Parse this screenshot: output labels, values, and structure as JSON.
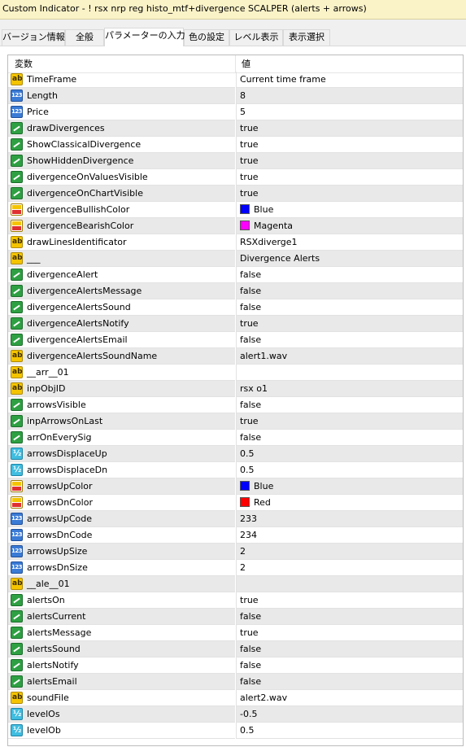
{
  "window": {
    "title": "Custom Indicator - ! rsx nrp reg histo_mtf+divergence SCALPER (alerts + arrows)"
  },
  "tabs": [
    {
      "label": "バージョン情報"
    },
    {
      "label": "全般"
    },
    {
      "label": "パラメーターの入力",
      "active": true
    },
    {
      "label": "色の設定"
    },
    {
      "label": "レベル表示"
    },
    {
      "label": "表示選択"
    }
  ],
  "grid": {
    "col_name": "変数",
    "col_value": "値",
    "rows": [
      {
        "name": "TimeFrame",
        "value": "Current time frame",
        "type": "ab"
      },
      {
        "name": "Length",
        "value": "8",
        "type": "int"
      },
      {
        "name": "Price",
        "value": "5",
        "type": "int"
      },
      {
        "name": "drawDivergences",
        "value": "true",
        "type": "bool"
      },
      {
        "name": "ShowClassicalDivergence",
        "value": "true",
        "type": "bool"
      },
      {
        "name": "ShowHiddenDivergence",
        "value": "true",
        "type": "bool"
      },
      {
        "name": "divergenceOnValuesVisible",
        "value": "true",
        "type": "bool"
      },
      {
        "name": "divergenceOnChartVisible",
        "value": "true",
        "type": "bool"
      },
      {
        "name": "divergenceBullishColor",
        "value": "Blue",
        "type": "color",
        "swatch": "#0000ff"
      },
      {
        "name": "divergenceBearishColor",
        "value": "Magenta",
        "type": "color",
        "swatch": "#ff00ff"
      },
      {
        "name": "drawLinesIdentificator",
        "value": "RSXdiverge1",
        "type": "ab"
      },
      {
        "name": "___",
        "value": "Divergence Alerts",
        "type": "ab"
      },
      {
        "name": "divergenceAlert",
        "value": "false",
        "type": "bool"
      },
      {
        "name": "divergenceAlertsMessage",
        "value": "false",
        "type": "bool"
      },
      {
        "name": "divergenceAlertsSound",
        "value": "false",
        "type": "bool"
      },
      {
        "name": "divergenceAlertsNotify",
        "value": "true",
        "type": "bool"
      },
      {
        "name": "divergenceAlertsEmail",
        "value": "false",
        "type": "bool"
      },
      {
        "name": "divergenceAlertsSoundName",
        "value": "alert1.wav",
        "type": "ab"
      },
      {
        "name": "__arr__01",
        "value": "",
        "type": "ab"
      },
      {
        "name": "inpObjID",
        "value": "rsx o1",
        "type": "ab"
      },
      {
        "name": "arrowsVisible",
        "value": "false",
        "type": "bool"
      },
      {
        "name": "inpArrowsOnLast",
        "value": "true",
        "type": "bool"
      },
      {
        "name": "arrOnEverySig",
        "value": "false",
        "type": "bool"
      },
      {
        "name": "arrowsDisplaceUp",
        "value": "0.5",
        "type": "dbl"
      },
      {
        "name": "arrowsDisplaceDn",
        "value": "0.5",
        "type": "dbl"
      },
      {
        "name": "arrowsUpColor",
        "value": "Blue",
        "type": "color",
        "swatch": "#0000ff"
      },
      {
        "name": "arrowsDnColor",
        "value": "Red",
        "type": "color",
        "swatch": "#ff0000"
      },
      {
        "name": "arrowsUpCode",
        "value": "233",
        "type": "int"
      },
      {
        "name": "arrowsDnCode",
        "value": "234",
        "type": "int"
      },
      {
        "name": "arrowsUpSize",
        "value": "2",
        "type": "int"
      },
      {
        "name": "arrowsDnSize",
        "value": "2",
        "type": "int"
      },
      {
        "name": "__ale__01",
        "value": "",
        "type": "ab"
      },
      {
        "name": "alertsOn",
        "value": "true",
        "type": "bool"
      },
      {
        "name": "alertsCurrent",
        "value": "false",
        "type": "bool"
      },
      {
        "name": "alertsMessage",
        "value": "true",
        "type": "bool"
      },
      {
        "name": "alertsSound",
        "value": "false",
        "type": "bool"
      },
      {
        "name": "alertsNotify",
        "value": "false",
        "type": "bool"
      },
      {
        "name": "alertsEmail",
        "value": "false",
        "type": "bool"
      },
      {
        "name": "soundFile",
        "value": "alert2.wav",
        "type": "ab"
      },
      {
        "name": "levelOs",
        "value": "-0.5",
        "type": "dbl"
      },
      {
        "name": "levelOb",
        "value": "0.5",
        "type": "dbl"
      }
    ]
  }
}
